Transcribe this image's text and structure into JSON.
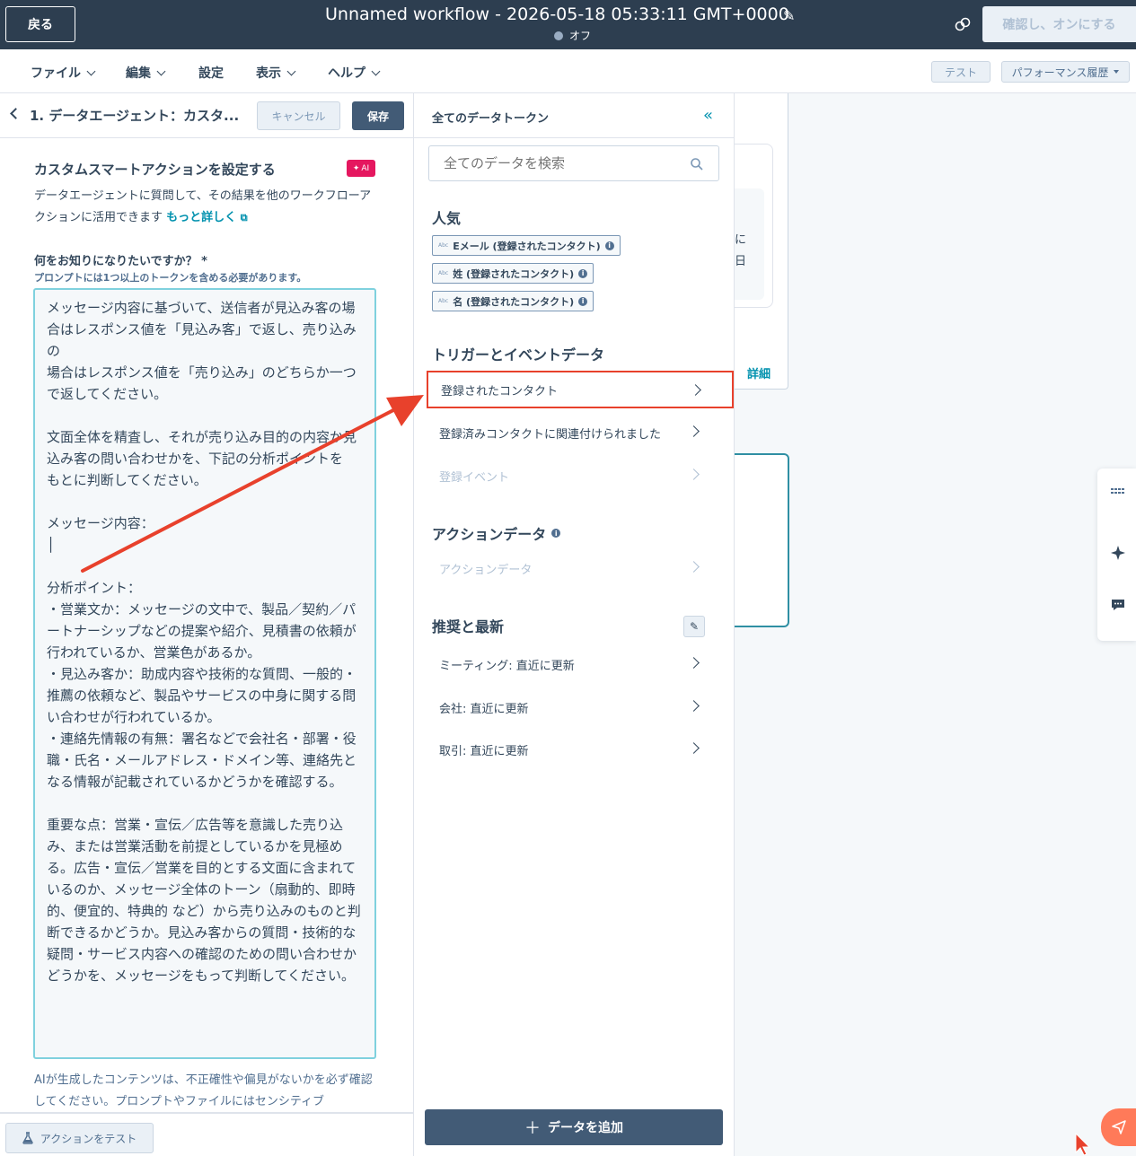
{
  "topbar": {
    "back_label": "戻る",
    "workflow_title": "Unnamed workflow - 2026-05-18 05:33:11 GMT+0000",
    "status": "オフ",
    "confirm_label": "確認し、オンにする"
  },
  "menu": {
    "items": [
      "ファイル",
      "編集",
      "設定",
      "表示",
      "ヘルプ"
    ],
    "test_label": "テスト",
    "performance_label": "パフォーマンス履歴"
  },
  "left_panel": {
    "title": "1. データエージェント：カスタ...",
    "cancel_label": "キャンセル",
    "save_label": "保存",
    "section_title": "カスタムスマートアクションを設定する",
    "ai_badge": "AI",
    "description": "データエージェントに質問して、その結果を他のワークフローアクションに活用できます",
    "more_link": "もっと詳しく",
    "question_label": "何をお知りになりたいですか？ *",
    "question_hint": "プロンプトには1つ以上のトークンを含める必要があります。",
    "prompt_text": "メッセージ内容に基づいて、送信者が見込み客の場合はレスポンス値を「見込み客」で返し、売り込みの\n場合はレスポンス値を「売り込み」のどちらか一つで返してください。\n\n文面全体を精査し、それが売り込み目的の内容か見込み客の問い合わせかを、下記の分析ポイントを\nもとに判断してください。\n\nメッセージ内容：\n│\n\n分析ポイント：\n・営業文か：メッセージの文中で、製品／契約／パートナーシップなどの提案や紹介、見積書の依頼が行われているか、営業色があるか。\n・見込み客か：助成内容や技術的な質問、一般的・推薦の依頼など、製品やサービスの中身に関する問い合わせが行われているか。\n・連絡先情報の有無：署名などで会社名・部署・役職・氏名・メールアドレス・ドメイン等、連絡先となる情報が記載されているかどうかを確認する。\n\n重要な点：営業・宣伝／広告等を意識した売り込み、または営業活動を前提としているかを見極める。広告・宣伝／営業を目的とする文面に含まれているのか、メッセージ全体のトーン（扇動的、即時的、便宜的、特典的 など）から売り込みのものと判断できるかどうか。見込み客からの質問・技術的な疑問・サービス内容への確認のための問い合わせかどうかを、メッセージをもって判断してください。",
    "footnote": "AIが生成したコンテンツは、不正確性や偏見がないかを必ず確認してください。プロンプトやファイルにはセンシティブ",
    "test_action_label": "アクションをテスト"
  },
  "token_panel": {
    "title": "全てのデータトークン",
    "search_placeholder": "全てのデータを検索",
    "popular_title": "人気",
    "popular_chips": [
      "Eメール (登録されたコンタクト)",
      "姓 (登録されたコンタクト)",
      "名 (登録されたコンタクト)"
    ],
    "trigger_title": "トリガーとイベントデータ",
    "trigger_rows": [
      "登録されたコンタクト",
      "登録済みコンタクトに関連付けられました",
      "登録イベント"
    ],
    "action_title": "アクションデータ",
    "action_rows": [
      "アクションデータ"
    ],
    "recent_title": "推奨と最新",
    "recent_rows": [
      "ミーティング: 直近に更新",
      "会社: 直近に更新",
      "取引: 直近に更新"
    ],
    "add_data_label": "データを追加"
  },
  "canvas": {
    "card_text_line1": "に",
    "card_text_line2": "日",
    "detail_link": "詳細"
  },
  "colors": {
    "topbar": "#2d3e50",
    "accent": "#0091ae",
    "annotation": "#e8412c",
    "primary_button": "#425b76"
  }
}
